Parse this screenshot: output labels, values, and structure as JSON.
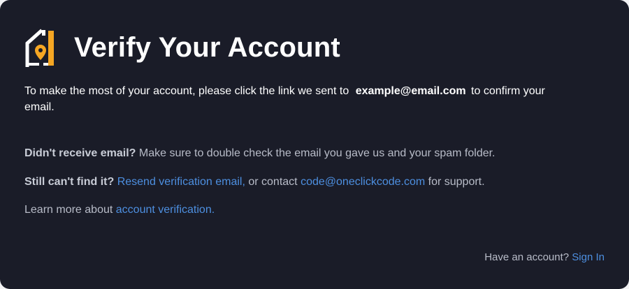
{
  "header": {
    "title": "Verify Your Account",
    "logo_icon": "house-location-pin-icon"
  },
  "intro": {
    "text_before": "To make the most of your account, please click the link we sent to",
    "email": "example@email.com",
    "text_after": "to confirm your email."
  },
  "help": {
    "not_received_label": "Didn't receive email?",
    "not_received_text": "Make sure to double check the email you gave us and your spam folder.",
    "still_cant_label": "Still can't find it?",
    "resend_link": "Resend verification email,",
    "contact_text": "or contact",
    "support_email": "code@oneclickcode.com",
    "support_suffix": "for support.",
    "learn_more_text": "Learn more about",
    "learn_more_link": "account verification."
  },
  "footer": {
    "have_account_text": "Have an account?",
    "sign_in_link": "Sign In"
  },
  "colors": {
    "background": "#1a1c28",
    "accent_link": "#4d8fe0",
    "logo_orange": "#f5a623",
    "text_primary": "#ffffff",
    "text_muted": "#b8bcc8"
  }
}
